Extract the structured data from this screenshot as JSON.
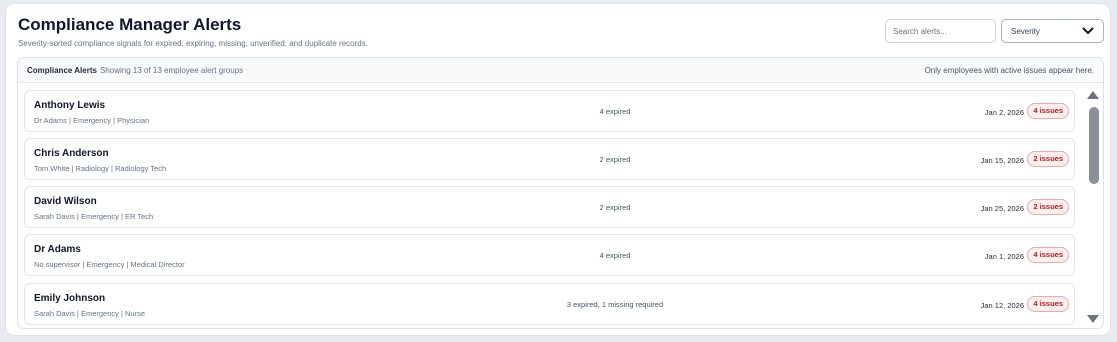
{
  "header": {
    "title": "Compliance Manager Alerts",
    "subtitle": "Severity-sorted compliance signals for expired, expiring, missing, unverified, and duplicate records."
  },
  "search": {
    "placeholder": "Search alerts..."
  },
  "severity_filter": {
    "value": "Severity"
  },
  "panel": {
    "title": "Compliance Alerts",
    "count_text": "Showing 13 of 13 employee alert groups",
    "note": "Only employees with active issues appear here."
  },
  "alerts": [
    {
      "name": "Anthony Lewis",
      "meta": "Dr Adams | Emergency | Physician",
      "summary": "4 expired",
      "date": "Jan 2, 2026",
      "badge": "4 issues"
    },
    {
      "name": "Chris Anderson",
      "meta": "Tom White | Radiology | Radiology Tech",
      "summary": "2 expired",
      "date": "Jan 15, 2026",
      "badge": "2 issues"
    },
    {
      "name": "David Wilson",
      "meta": "Sarah Davis | Emergency | ER Tech",
      "summary": "2 expired",
      "date": "Jan 25, 2026",
      "badge": "2 issues"
    },
    {
      "name": "Dr Adams",
      "meta": "No supervisor | Emergency | Medical Director",
      "summary": "4 expired",
      "date": "Jan 1, 2026",
      "badge": "4 issues"
    },
    {
      "name": "Emily Johnson",
      "meta": "Sarah Davis | Emergency | Nurse",
      "summary": "3 expired, 1 missing required",
      "date": "Jan 12, 2026",
      "badge": "4 issues"
    }
  ],
  "icons": {
    "select": "chevron-down-icon",
    "scroll_up": "triangle-up-icon",
    "scroll_down": "triangle-down-icon"
  },
  "colors": {
    "badge_text": "#b91c1c",
    "badge_bg": "#fef0f0",
    "badge_border": "#f5a6a6"
  }
}
